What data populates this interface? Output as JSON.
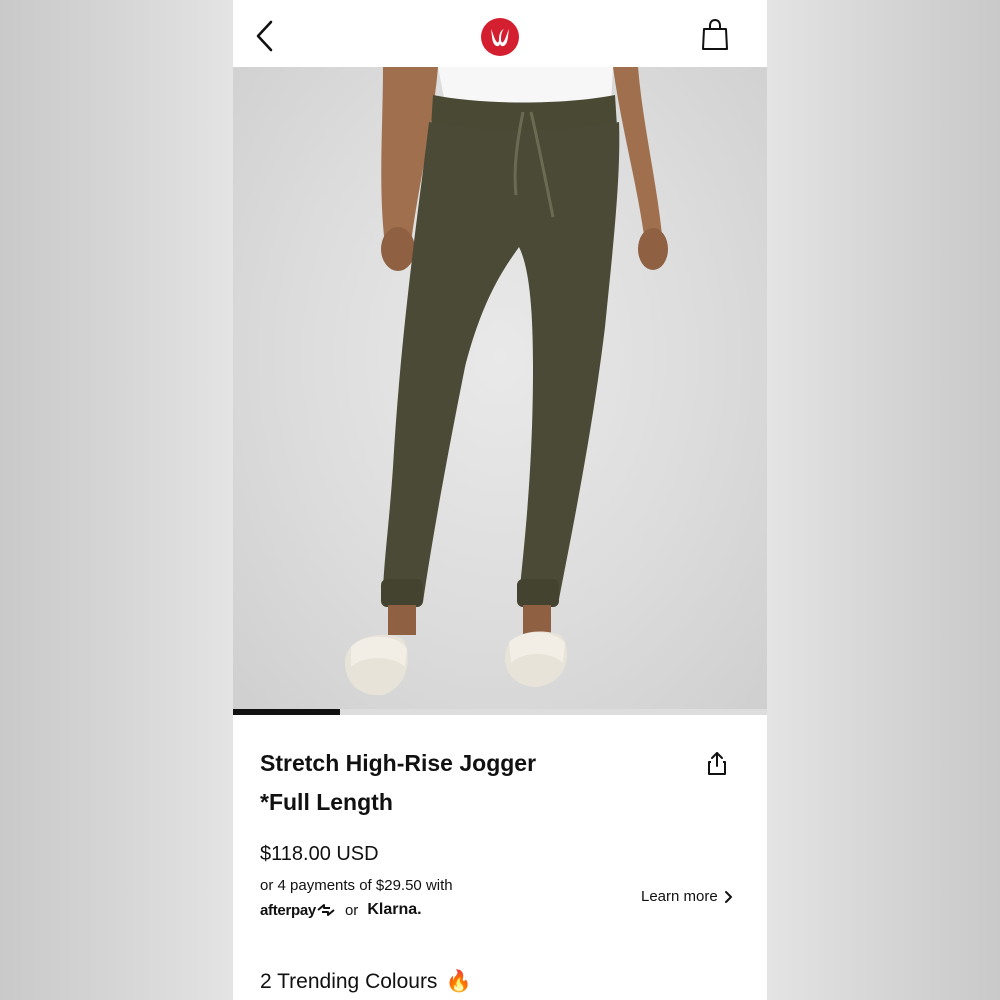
{
  "header": {
    "back_icon": "chevron-left-icon",
    "logo_icon": "lululemon-logo",
    "bag_icon": "shopping-bag-icon",
    "brand_color": "#d31f2f"
  },
  "gallery": {
    "image_description_icon": "product-image",
    "progress_fraction": 0.2
  },
  "product": {
    "title_line1": "Stretch High-Rise Jogger",
    "title_line2": "*Full Length",
    "share_icon": "share-icon",
    "price": "$118.00 USD",
    "installments": "or 4 payments of $29.50 with",
    "afterpay_label": "afterpay",
    "or_label": "or",
    "klarna_label": "Klarna.",
    "learn_more": "Learn more",
    "trending": "2 Trending Colours",
    "trending_emoji": "🔥"
  }
}
